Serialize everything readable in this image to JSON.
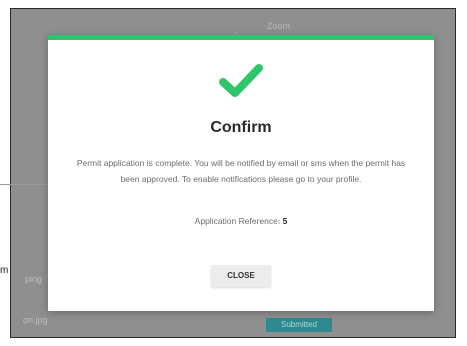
{
  "background": {
    "zoom_label": "Zoom",
    "left_fragment": "m",
    "file_png": "ping",
    "file_jpg": "on.jpg",
    "submit_label": "Submitted"
  },
  "modal": {
    "icon": "checkmark-icon",
    "accent_color": "#2ec56b",
    "title": "Confirm",
    "message": "Permit application is complete. You will be notified by email or sms when the permit has been approved. To enable notifications please go to your profile.",
    "reference_label": "Application Reference:",
    "reference_value": "5",
    "close_label": "CLOSE"
  }
}
